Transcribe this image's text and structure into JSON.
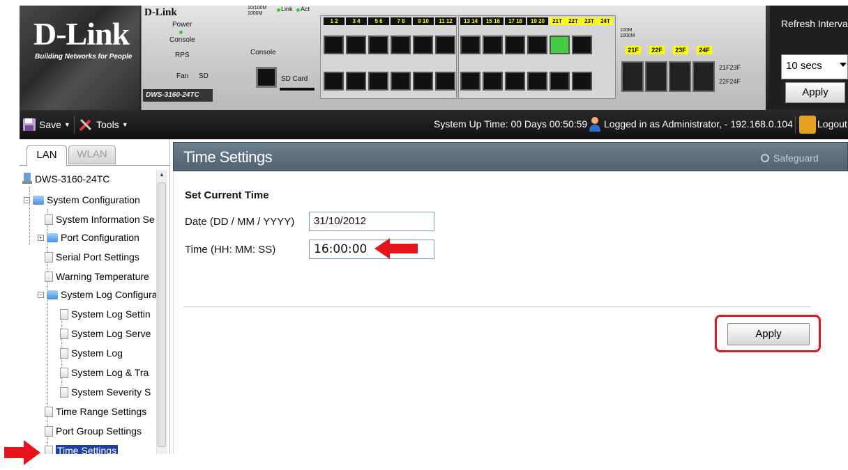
{
  "header": {
    "logo": "D-Link",
    "logo_tagline": "Building Networks for People",
    "device": {
      "brand": "D-Link",
      "model": "DWS-3160-24TC",
      "led_labels": [
        "Power",
        "Console",
        "RPS",
        "Fan",
        "SD"
      ],
      "link_legend": "Link",
      "act_legend": "Act",
      "speed_legend": "10/100M 1000M",
      "console_label": "Console",
      "sdcard_label": "SD Card",
      "port_pairs": [
        "1 2",
        "3 4",
        "5 6",
        "7 8",
        "9 10",
        "11 12",
        "13 14",
        "15 16",
        "17 18",
        "19 20"
      ],
      "combo_ports": [
        "21T",
        "22T",
        "23T",
        "24T"
      ],
      "sfp_ports": [
        "21F",
        "22F",
        "23F",
        "24F"
      ],
      "sfp_side_labels": [
        "21F23F",
        "22F24F"
      ],
      "speed_legend_2": "100M 1000M"
    },
    "refresh": {
      "label": "Refresh Interval",
      "value": "10 secs",
      "apply_label": "Apply"
    }
  },
  "toolbar": {
    "save_label": "Save",
    "tools_label": "Tools",
    "uptime": "System Up Time: 00 Days 00:50:59",
    "login_status": "Logged in as Administrator, - 192.168.0.104",
    "logout_label": "Logout"
  },
  "sidebar": {
    "tabs": [
      {
        "label": "LAN",
        "active": true
      },
      {
        "label": "WLAN",
        "active": false
      }
    ],
    "tree": {
      "root": "DWS-3160-24TC",
      "items": [
        {
          "label": "System Configuration"
        },
        {
          "label": "System Information Se"
        },
        {
          "label": "Port Configuration"
        },
        {
          "label": "Serial Port Settings"
        },
        {
          "label": "Warning Temperature"
        },
        {
          "label": "System Log Configura"
        },
        {
          "label": "System Log Settin"
        },
        {
          "label": "System Log Serve"
        },
        {
          "label": "System Log"
        },
        {
          "label": "System Log & Tra"
        },
        {
          "label": "System Severity S"
        },
        {
          "label": "Time Range Settings"
        },
        {
          "label": "Port Group Settings"
        },
        {
          "label": "Time Settings",
          "selected": true
        }
      ]
    }
  },
  "main": {
    "title": "Time Settings",
    "safeguard": "Safeguard",
    "section_title": "Set Current Time",
    "date_label": "Date (DD / MM / YYYY)",
    "date_value": "31/10/2012",
    "time_label": "Time (HH: MM: SS)",
    "time_value": "16:00:00",
    "apply_label": "Apply"
  },
  "colors": {
    "annotation_red": "#e8141c",
    "title_bar": "#5e7180",
    "selected": "#1e3fa0"
  }
}
